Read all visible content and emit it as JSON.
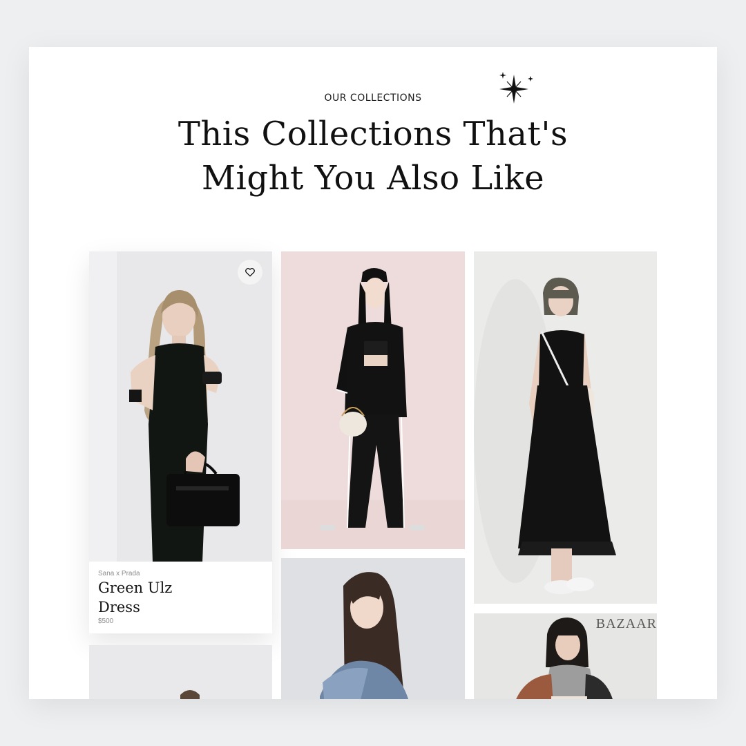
{
  "header": {
    "eyebrow": "OUR COLLECTIONS",
    "title_line1": "This Collections That's",
    "title_line2": "Might You Also Like"
  },
  "icons": {
    "sparkle": "sparkle-icon",
    "favorite": "heart-outline-icon"
  },
  "featured_product": {
    "brand": "Sana x Prada",
    "name": "Green Ulz Dress",
    "price": "$500"
  },
  "tiles": [
    {
      "magazine_logo": ""
    },
    {
      "magazine_logo": ""
    },
    {
      "magazine_logo": ""
    },
    {
      "magazine_logo": "BAZAAR"
    }
  ],
  "colors": {
    "background": "#eeeff1",
    "card": "#ffffff",
    "text": "#111111",
    "muted": "#8b8b8b"
  }
}
